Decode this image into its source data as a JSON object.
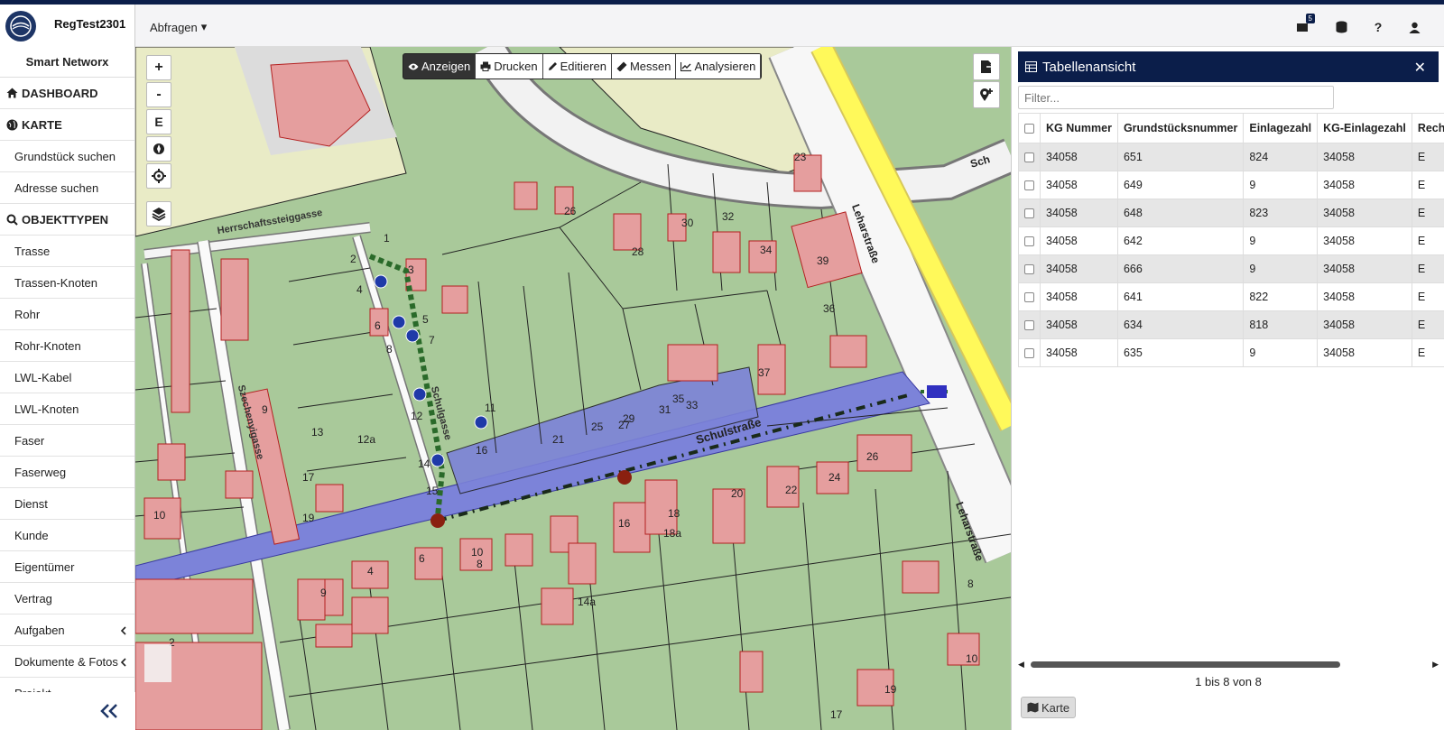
{
  "app": {
    "title": "RegTest2301",
    "name": "Smart Networx"
  },
  "header": {
    "dropdown_label": "Abfragen",
    "notifications_count": "5"
  },
  "sidebar": {
    "items": [
      {
        "label": "DASHBOARD",
        "type": "section",
        "icon": "home-icon"
      },
      {
        "label": "KARTE",
        "type": "section",
        "icon": "globe-icon"
      },
      {
        "label": "Grundstück suchen",
        "type": "item"
      },
      {
        "label": "Adresse suchen",
        "type": "item"
      },
      {
        "label": "OBJEKTTYPEN",
        "type": "section",
        "icon": "search-icon"
      },
      {
        "label": "Trasse",
        "type": "item"
      },
      {
        "label": "Trassen-Knoten",
        "type": "item"
      },
      {
        "label": "Rohr",
        "type": "item"
      },
      {
        "label": "Rohr-Knoten",
        "type": "item"
      },
      {
        "label": "LWL-Kabel",
        "type": "item"
      },
      {
        "label": "LWL-Knoten",
        "type": "item"
      },
      {
        "label": "Faser",
        "type": "item"
      },
      {
        "label": "Faserweg",
        "type": "item"
      },
      {
        "label": "Dienst",
        "type": "item"
      },
      {
        "label": "Kunde",
        "type": "item"
      },
      {
        "label": "Eigentümer",
        "type": "item"
      },
      {
        "label": "Vertrag",
        "type": "item"
      },
      {
        "label": "Aufgaben",
        "type": "item",
        "expandable": true
      },
      {
        "label": "Dokumente & Fotos",
        "type": "item",
        "expandable": true
      },
      {
        "label": "Projekt",
        "type": "item"
      }
    ]
  },
  "map": {
    "controls": {
      "zoom_in": "+",
      "zoom_out": "-",
      "edit": "E"
    },
    "toolbar": [
      {
        "label": "Anzeigen",
        "icon": "eye-icon",
        "active": true
      },
      {
        "label": "Drucken",
        "icon": "print-icon",
        "active": false
      },
      {
        "label": "Editieren",
        "icon": "pencil-icon",
        "active": false
      },
      {
        "label": "Messen",
        "icon": "ruler-icon",
        "active": false
      },
      {
        "label": "Analysieren",
        "icon": "chart-icon",
        "active": false
      }
    ],
    "street_labels": [
      "Schulstraße",
      "Leharstraße",
      "Leharstraße",
      "Herrschaftssteiggasse",
      "Szechenyigasse",
      "Schulgasse",
      "Sch"
    ],
    "house_numbers": [
      "1",
      "2",
      "3",
      "4",
      "5",
      "6",
      "7",
      "8",
      "9",
      "10",
      "11",
      "12",
      "12a",
      "13",
      "14",
      "15",
      "16",
      "17",
      "18",
      "19",
      "20",
      "21",
      "22",
      "23",
      "24",
      "25",
      "26",
      "27",
      "28",
      "29",
      "30",
      "31",
      "32",
      "33",
      "34",
      "35",
      "36",
      "37",
      "39",
      "14a",
      "18a",
      "8",
      "2",
      "9",
      "4",
      "6",
      "8",
      "10",
      "16",
      "17",
      "26",
      "19",
      "10"
    ],
    "colors": {
      "parcel": "#a9c99a",
      "building": "#e59e9e",
      "highlight": "#7c83d9",
      "road": "#ffffff",
      "highway": "#fff95a"
    }
  },
  "table_panel": {
    "title": "Tabellenansicht",
    "filter_placeholder": "Filter...",
    "columns": [
      "KG Nummer",
      "Grundstücksnummer",
      "Einlagezahl",
      "KG-Einlagezahl",
      "Recht"
    ],
    "rows": [
      [
        "34058",
        "651",
        "824",
        "34058",
        "E"
      ],
      [
        "34058",
        "649",
        "9",
        "34058",
        "E"
      ],
      [
        "34058",
        "648",
        "823",
        "34058",
        "E"
      ],
      [
        "34058",
        "642",
        "9",
        "34058",
        "E"
      ],
      [
        "34058",
        "666",
        "9",
        "34058",
        "E"
      ],
      [
        "34058",
        "641",
        "822",
        "34058",
        "E"
      ],
      [
        "34058",
        "634",
        "818",
        "34058",
        "E"
      ],
      [
        "34058",
        "635",
        "9",
        "34058",
        "E"
      ]
    ],
    "paging": "1 bis 8 von 8",
    "map_button": "Karte"
  }
}
